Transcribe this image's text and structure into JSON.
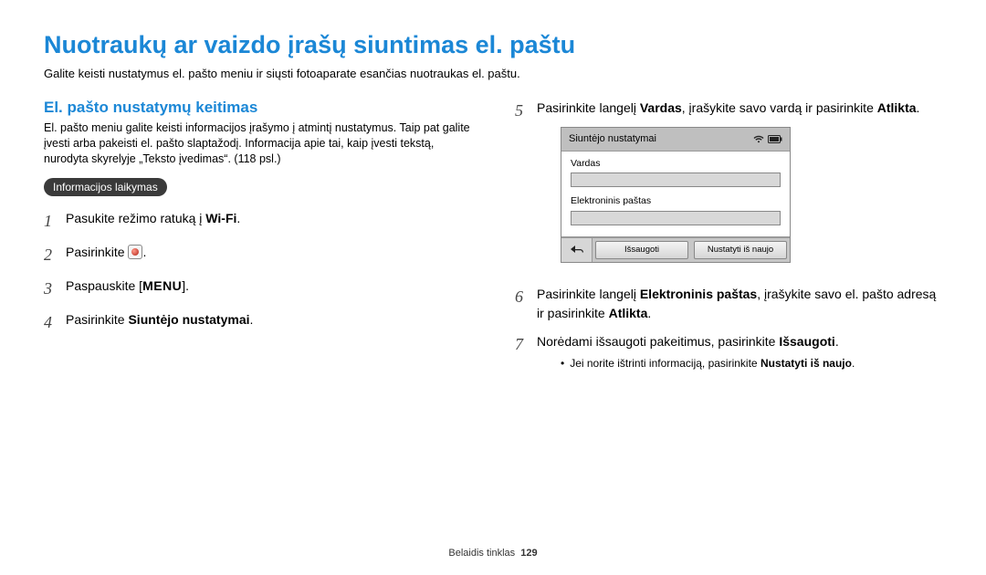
{
  "title": "Nuotraukų ar vaizdo įrašų siuntimas el. paštu",
  "intro": "Galite keisti nustatymus el. pašto meniu ir siųsti fotoaparate esančias nuotraukas el. paštu.",
  "left": {
    "subtitle": "El. pašto nustatymų keitimas",
    "desc": "El. pašto meniu galite keisti informacijos įrašymo į atmintį nustatymus. Taip pat galite įvesti arba pakeisti el. pašto slaptažodį. Informacija apie tai, kaip įvesti tekstą, nurodyta skyrelyje „Teksto įvedimas“. (118 psl.)",
    "badge": "Informacijos laikymas",
    "steps": {
      "s1_a": "Pasukite režimo ratuką į ",
      "s1_b": ".",
      "wifi": "Wi-Fi",
      "s2_a": "Pasirinkite ",
      "s2_b": ".",
      "s3_a": "Paspauskite [",
      "menu": "MENU",
      "s3_b": "].",
      "s4_a": "Pasirinkite ",
      "s4_bold": "Siuntėjo nustatymai",
      "s4_b": "."
    }
  },
  "right": {
    "s5_a": "Pasirinkite langelį ",
    "s5_bold1": "Vardas",
    "s5_mid": ", įrašykite savo vardą ir pasirinkite ",
    "s5_bold2": "Atlikta",
    "s5_end": ".",
    "device": {
      "header": "Siuntėjo nustatymai",
      "field1": "Vardas",
      "field2": "Elektroninis paštas",
      "btn_save": "Išsaugoti",
      "btn_reset": "Nustatyti iš naujo"
    },
    "s6_a": "Pasirinkite langelį ",
    "s6_bold1": "Elektroninis paštas",
    "s6_mid": ", įrašykite savo el. pašto adresą ir pasirinkite ",
    "s6_bold2": "Atlikta",
    "s6_end": ".",
    "s7_a": "Norėdami išsaugoti pakeitimus, pasirinkite ",
    "s7_bold": "Išsaugoti",
    "s7_end": ".",
    "bullet_a": "Jei norite ištrinti informaciją, pasirinkite ",
    "bullet_bold": "Nustatyti iš naujo",
    "bullet_end": "."
  },
  "footer": {
    "section": "Belaidis tinklas",
    "page": "129"
  }
}
